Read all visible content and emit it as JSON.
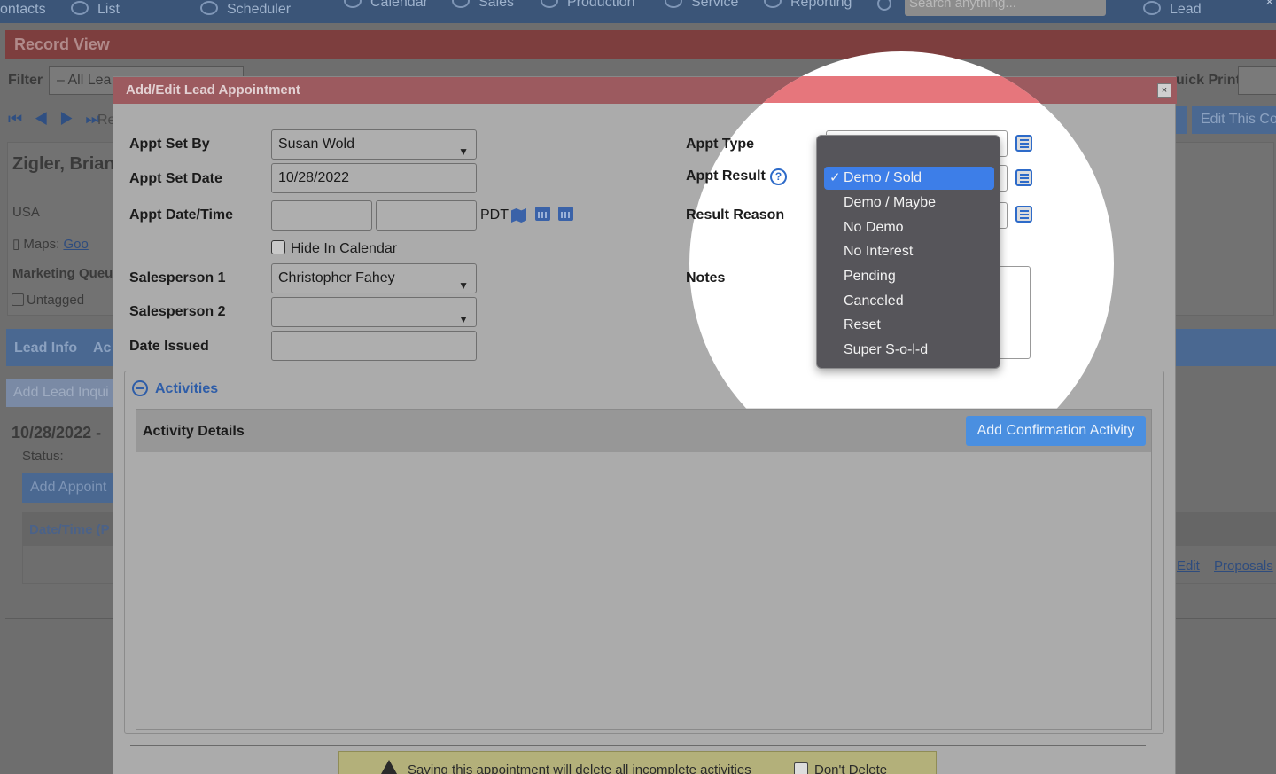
{
  "nav": {
    "items": [
      "ontacts",
      "List",
      "Scheduler",
      "Calendar",
      "Sales",
      "Production",
      "Service",
      "Reporting",
      "Lead"
    ],
    "search_placeholder": "Search anything...",
    "close": "×"
  },
  "record": {
    "bar_title": "Record View",
    "filter_label": "Filter",
    "filter_value": "– All Lea",
    "quick_print_label": "uick Print",
    "pager_icons": "⏮ ◀ ▶ ⏭",
    "pager_text": "Re",
    "edit_contact": "Edit This Co",
    "contact_name": "Zigler, Brian",
    "country": "USA",
    "maps_label": "Maps:",
    "maps_link": "Goo",
    "marketing_label": "Marketing Queu",
    "untagged": "Untagged",
    "tab_lead_info": "Lead Info",
    "tab_ac": "Ac",
    "add_lead_inquiry": "Add Lead Inqui",
    "appt_heading": "10/28/2022 -",
    "status_label": "Status:",
    "add_appointment": "Add Appoint",
    "th_date": "Date/Time (P",
    "link_edit": "Edit",
    "link_proposals": "Proposals"
  },
  "modal": {
    "title": "Add/Edit Lead Appointment",
    "close": "×",
    "fields": {
      "appt_set_by_label": "Appt Set By",
      "appt_set_by_value": "Susan Wold",
      "appt_set_date_label": "Appt Set Date",
      "appt_set_date_value": "10/28/2022",
      "appt_datetime_label": "Appt Date/Time",
      "timezone": "PDT",
      "hide_calendar_label": "Hide In Calendar",
      "salesperson1_label": "Salesperson 1",
      "salesperson1_value": "Christopher Fahey",
      "salesperson2_label": "Salesperson 2",
      "date_issued_label": "Date Issued",
      "appt_type_label": "Appt Type",
      "appt_result_label": "Appt Result",
      "result_reason_label": "Result Reason",
      "notes_label": "Notes"
    },
    "activities": {
      "title": "Activities",
      "table_header": "Activity Details",
      "add_button": "Add Confirmation Activity"
    },
    "warning": {
      "text": "Saving this appointment will delete all incomplete activities",
      "dont_delete": "Don't Delete"
    }
  },
  "dropdown": {
    "check": "✓",
    "options": [
      "Demo / Sold",
      "Demo / Maybe",
      "No Demo",
      "No Interest",
      "Pending",
      "Canceled",
      "Reset",
      "Super S-o-l-d"
    ],
    "selected": "Demo / Sold"
  },
  "colors": {
    "accent_blue": "#3d7ee8",
    "modal_header": "#e6767c",
    "spotlight_bg": "#ffffff"
  }
}
